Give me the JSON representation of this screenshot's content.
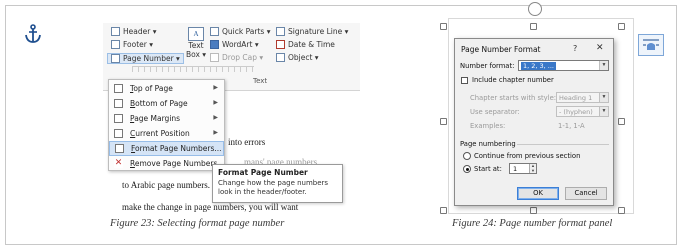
{
  "left_figure": {
    "ribbon": {
      "header_label": "Header ▾",
      "footer_label": "Footer ▾",
      "page_number_label": "Page Number ▾",
      "text_box_label": "Text",
      "text_box_label2": "Box ▾",
      "quick_parts_label": "Quick Parts ▾",
      "wordart_label": "WordArt ▾",
      "drop_cap_label": "Drop Cap ▾",
      "signature_line_label": "Signature Line ▾",
      "date_time_label": "Date & Time",
      "object_label": "Object ▾",
      "text_group_label": "Text"
    },
    "menu": {
      "items": [
        {
          "label": "Top of Page",
          "ul": "T",
          "rest": "op of Page",
          "has_submenu": true
        },
        {
          "label": "Bottom of Page",
          "ul": "B",
          "rest": "ottom of Page",
          "has_submenu": true
        },
        {
          "label": "Page Margins",
          "ul": "P",
          "rest": "age Margins",
          "has_submenu": true
        },
        {
          "label": "Current Position",
          "ul": "C",
          "rest": "urrent Position",
          "has_submenu": true
        },
        {
          "label": "Format Page Numbers...",
          "ul": "F",
          "rest": "ormat Page Numbers...",
          "has_submenu": false,
          "highlighted": true
        },
        {
          "label": "Remove Page Numbers",
          "ul": "R",
          "rest": "emove Page Numbers",
          "has_submenu": false
        }
      ]
    },
    "tooltip": {
      "title": "Format Page Number",
      "body_line1": "Change how the page numbers",
      "body_line2": "look in the header/footer."
    },
    "doc_lines": {
      "line1": "into errors",
      "line2": "mans' page numbers",
      "line3": "to Arabic page numbers.",
      "line4": "make the change in page numbers, you will want"
    },
    "caption": "Figure 23: Selecting format page number"
  },
  "right_figure": {
    "dialog": {
      "title": "Page Number Format",
      "help": "?",
      "close": "✕",
      "number_format_label": "Number format:",
      "number_format_value": "1, 2, 3, ...",
      "include_chapter_label": "Include chapter number",
      "chapter_starts_label": "Chapter starts with style:",
      "chapter_starts_value": "Heading 1",
      "use_separator_label": "Use separator:",
      "use_separator_value": "-  (hyphen)",
      "examples_label": "Examples:",
      "examples_value": "1-1, 1-A",
      "page_numbering_label": "Page numbering",
      "continue_label": "Continue from previous section",
      "start_at_label": "Start at:",
      "start_at_value": "1",
      "ok_label": "OK",
      "cancel_label": "Cancel"
    },
    "caption": "Figure 24: Page number format panel"
  },
  "colors": {
    "highlight": "#d5e4f6",
    "accent": "#3a78c8",
    "anchor": "#1f4f8f"
  }
}
